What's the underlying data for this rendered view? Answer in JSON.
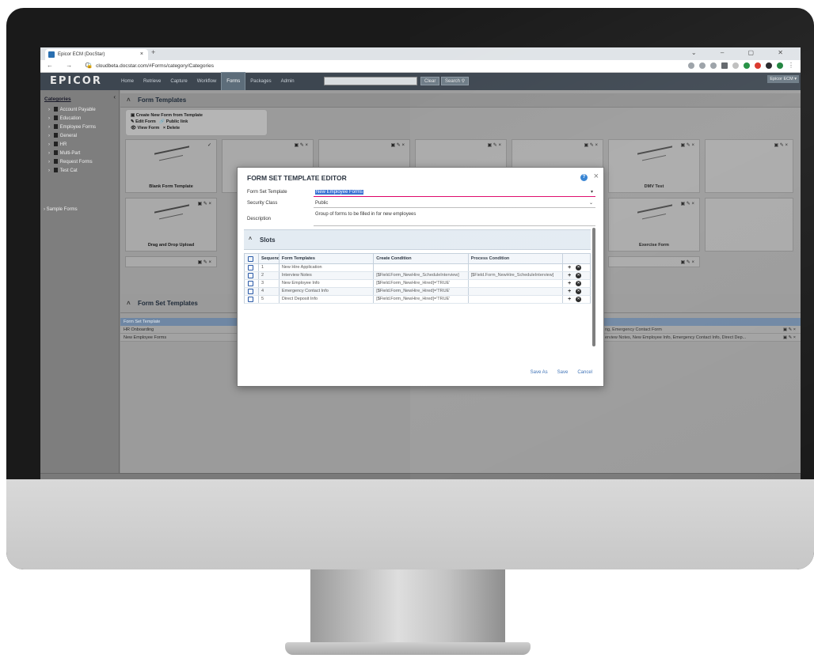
{
  "browser": {
    "tab_title": "Epicor ECM (DocStar)",
    "tab_close": "×",
    "new_tab": "+",
    "window_controls": "⌄ – ▢ ✕",
    "nav_controls": "← → C",
    "url": "cloudbeta.docstar.com/#Forms/category/Categories"
  },
  "app": {
    "logo": "EPICOR",
    "menu": [
      "Home",
      "Retrieve",
      "Capture",
      "Workflow",
      "Forms",
      "Packages",
      "Admin"
    ],
    "active_menu": "Forms",
    "clear_button": "Clear",
    "search_button": "Search",
    "user_badge": "Epicor ECM ▾"
  },
  "sidebar": {
    "title": "Categories",
    "collapse": "‹",
    "items": [
      "Account Payable",
      "Education",
      "Employee Forms",
      "General",
      "HR",
      "Multi-Part",
      "Request Forms",
      "Test Cat"
    ],
    "sample_forms": "Sample Forms"
  },
  "form_templates": {
    "header": "Form Templates",
    "actions": {
      "create": "Create New Form from Template",
      "edit": "Edit Form",
      "public_link": "Public link",
      "view": "View Form",
      "delete": "Delete"
    },
    "cards": [
      "Blank Form Template",
      "DMV Test",
      "Drag and Drop Upload",
      "Exercise Form"
    ]
  },
  "form_set_templates": {
    "header": "Form Set Templates",
    "column": "Form Set Template",
    "rows": [
      {
        "name": "HR Onboarding",
        "forms": "ng, Emergency Contact Form"
      },
      {
        "name": "New Employee Forms",
        "forms": "erview Notes, New Employee Info, Emergency Contact Info, Direct Dep..."
      }
    ]
  },
  "modal": {
    "title": "FORM SET TEMPLATE EDITOR",
    "help": "?",
    "close": "×",
    "fields": {
      "form_set_template_label": "Form Set Template",
      "form_set_template_value": "New Employee Forms",
      "security_class_label": "Security Class",
      "security_class_value": "Public",
      "description_label": "Description",
      "description_value": "Group of forms to be filled in for new employees"
    },
    "slots_title": "Slots",
    "grid": {
      "headers": [
        "Sequence",
        "Form Templates",
        "Create Condition",
        "Process Condition"
      ],
      "rows": [
        {
          "seq": "1",
          "template": "New Hire Application",
          "create": "",
          "process": ""
        },
        {
          "seq": "2",
          "template": "Interview Notes",
          "create": "[$Field.Form_NewHire_ScheduleInterview]",
          "process": "[$Field.Form_NewHire_ScheduleInterview]"
        },
        {
          "seq": "3",
          "template": "New Employee Info",
          "create": "[$Field.Form_NewHire_Hired]='TRUE'",
          "process": ""
        },
        {
          "seq": "4",
          "template": "Emergency Contact Info",
          "create": "[$Field.Form_NewHire_Hired]='TRUE'",
          "process": ""
        },
        {
          "seq": "5",
          "template": "Direct Deposit Info",
          "create": "[$Field.Form_NewHire_Hired]='TRUE'",
          "process": ""
        }
      ]
    },
    "footer": {
      "save_as": "Save As",
      "save": "Save",
      "cancel": "Cancel"
    }
  }
}
